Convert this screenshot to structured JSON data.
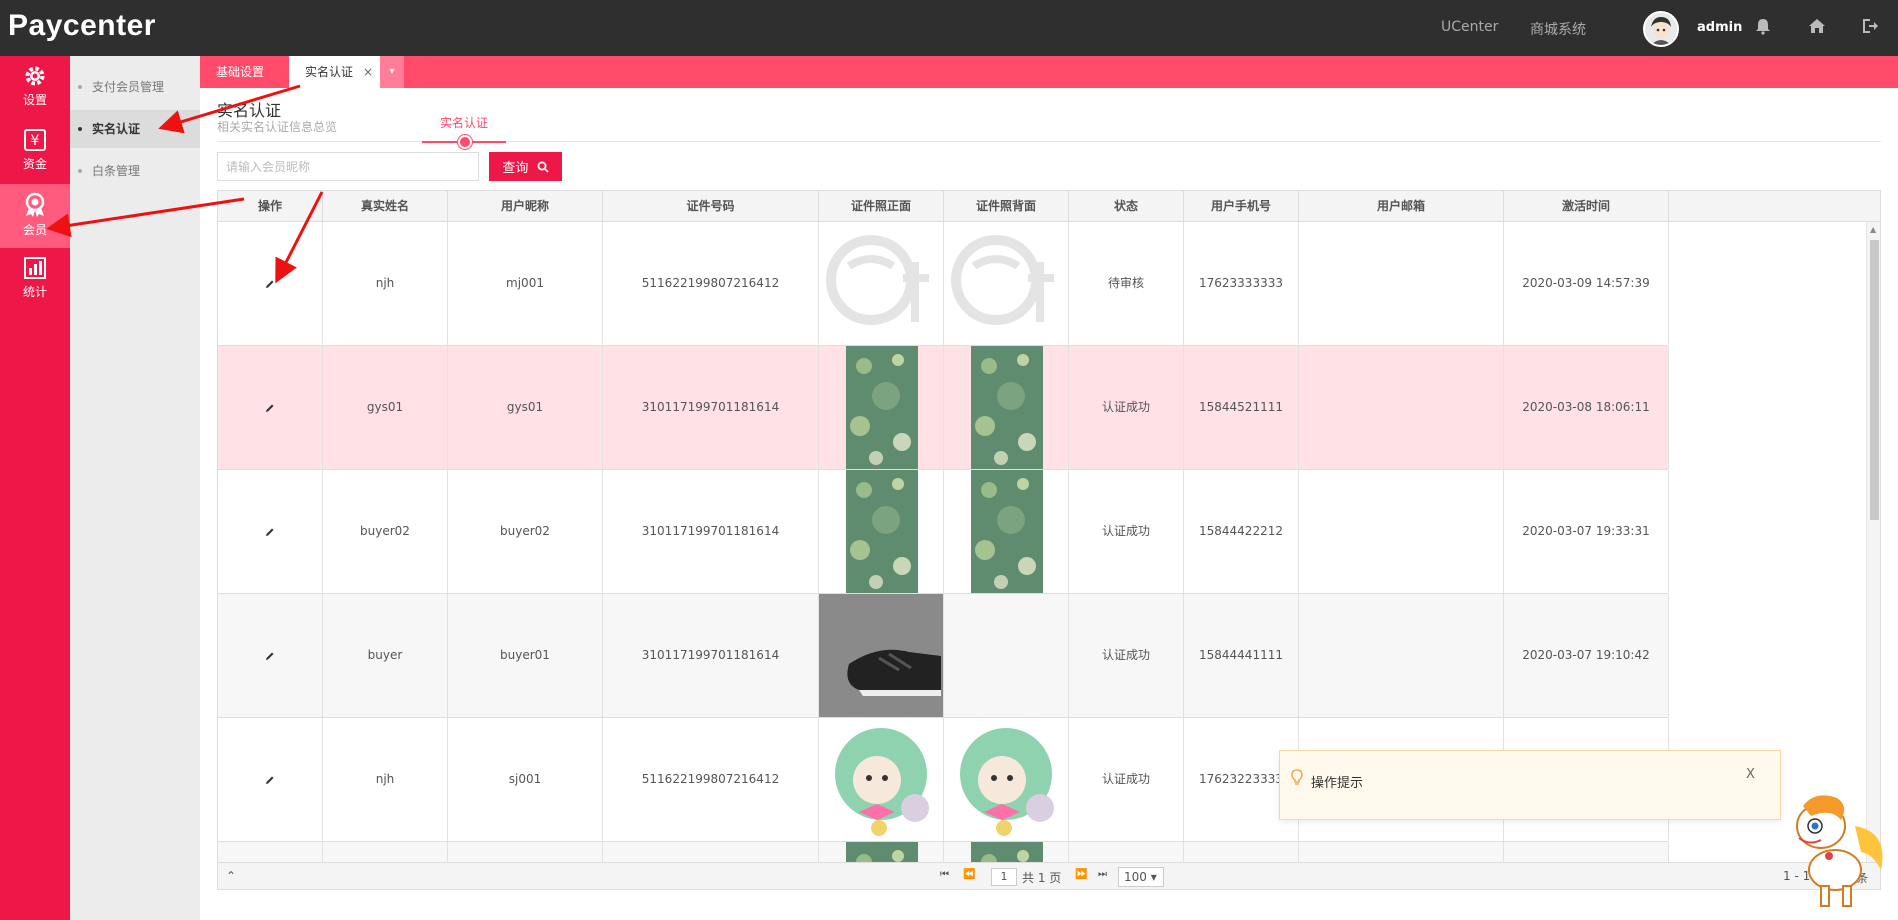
{
  "app": {
    "logo": "Paycenter"
  },
  "topbar": {
    "links": [
      "UCenter",
      "商城系统"
    ],
    "user": "admin",
    "icons": [
      "bell-icon",
      "home-icon",
      "logout-icon"
    ]
  },
  "leftnav": {
    "items": [
      {
        "label": "设置",
        "icon": "gear-icon"
      },
      {
        "label": "资金",
        "icon": "yen-icon"
      },
      {
        "label": "会员",
        "icon": "medal-icon"
      },
      {
        "label": "统计",
        "icon": "bar-chart-icon"
      }
    ]
  },
  "submenu": {
    "items": [
      "支付会员管理",
      "实名认证",
      "白条管理"
    ]
  },
  "tabs": {
    "items": [
      "基础设置",
      "实名认证"
    ],
    "close": "×",
    "more": "▾"
  },
  "page": {
    "title": "实名认证",
    "subtitle": "相关实名认证信息总览",
    "step": "实名认证"
  },
  "search": {
    "placeholder": "请输入会员昵称",
    "button": "查询"
  },
  "table": {
    "headers": [
      "操作",
      "真实姓名",
      "用户昵称",
      "证件号码",
      "证件照正面",
      "证件照背面",
      "状态",
      "用户手机号",
      "用户邮箱",
      "激活时间"
    ],
    "rows": [
      {
        "name": "njh",
        "nick": "mj001",
        "id": "511622199807216412",
        "status": "待审核",
        "phone": "17623333333",
        "email": "",
        "time": "2020-03-09 14:57:39"
      },
      {
        "name": "gys01",
        "nick": "gys01",
        "id": "310117199701181614",
        "status": "认证成功",
        "phone": "15844521111",
        "email": "",
        "time": "2020-03-08 18:06:11"
      },
      {
        "name": "buyer02",
        "nick": "buyer02",
        "id": "310117199701181614",
        "status": "认证成功",
        "phone": "15844422212",
        "email": "",
        "time": "2020-03-07 19:33:31"
      },
      {
        "name": "buyer",
        "nick": "buyer01",
        "id": "310117199701181614",
        "status": "认证成功",
        "phone": "15844441111",
        "email": "",
        "time": "2020-03-07 19:10:42"
      },
      {
        "name": "njh",
        "nick": "sj001",
        "id": "511622199807216412",
        "status": "认证成功",
        "phone": "17623223333",
        "email": "",
        "time": ""
      },
      {
        "name": "",
        "nick": "",
        "id": "",
        "status": "",
        "phone": "",
        "email": "",
        "time": ""
      }
    ]
  },
  "pager": {
    "page": "1",
    "total_pages": "共 1 页",
    "page_size": "100",
    "range": "1 - 15",
    "count": "15 条"
  },
  "toast": {
    "text": "操作提示",
    "close": "X"
  },
  "colors": {
    "accent": "#ee1848",
    "tabbar": "#ff4a6a",
    "topbar": "#2f2f2f",
    "highlight_row": "#ffe1e6"
  }
}
